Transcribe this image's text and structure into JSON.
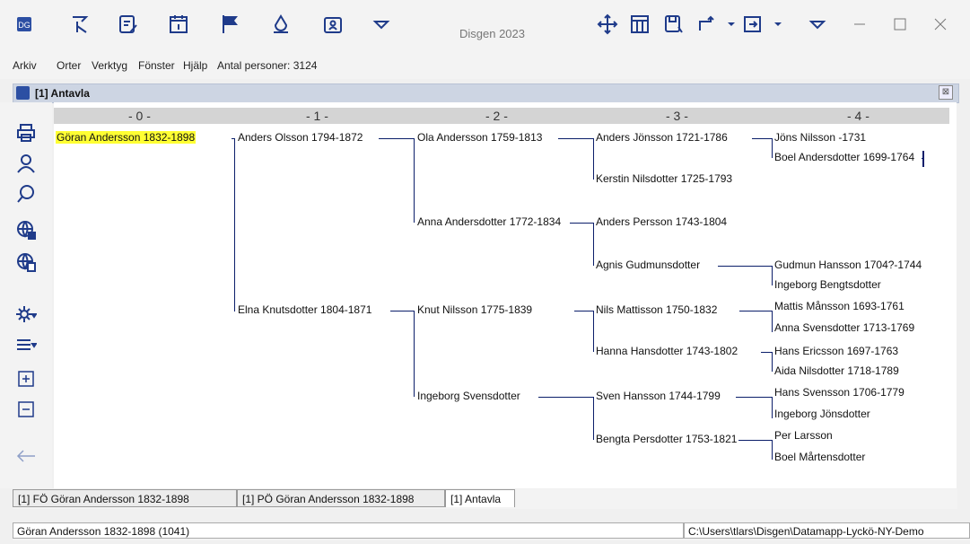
{
  "app_title": "Disgen 2023",
  "menu": {
    "arkiv": "Arkiv",
    "orter": "Orter",
    "verktyg": "Verktyg",
    "fonster": "Fönster",
    "hjalp": "Hjälp",
    "count": "Antal personer: 3124"
  },
  "doc": {
    "title": "[1] Antavla",
    "close": "⊠"
  },
  "generations": [
    "- 0 -",
    "- 1 -",
    "- 2 -",
    "- 3 -",
    "- 4 -"
  ],
  "people": [
    "Göran Andersson 1832-1898",
    "Anders Olsson 1794-1872",
    "Elna Knutsdotter 1804-1871",
    "Ola Andersson 1759-1813",
    "Anna Andersdotter 1772-1834",
    "Knut Nilsson 1775-1839",
    "Ingeborg Svensdotter",
    "Anders Jönsson 1721-1786",
    "Kerstin Nilsdotter 1725-1793",
    "Anders Persson 1743-1804",
    "Agnis Gudmunsdotter",
    "Nils Mattisson 1750-1832",
    "Hanna Hansdotter 1743-1802",
    "Sven Hansson 1744-1799",
    "Bengta Persdotter 1753-1821",
    "Jöns Nilsson -1731",
    "Boel Andersdotter 1699-1764",
    "Gudmun Hansson 1704?-1744",
    "Ingeborg Bengtsdotter",
    "Mattis Månsson 1693-1761",
    "Anna Svensdotter 1713-1769",
    "Hans Ericsson 1697-1763",
    "Aida Nilsdotter 1718-1789",
    "Hans Svensson 1706-1779",
    "Ingeborg Jönsdotter",
    "Per Larsson",
    "Boel Mårtensdotter"
  ],
  "tabs": [
    "[1]  FÖ Göran Andersson 1832-1898",
    "[1]  PÖ Göran Andersson 1832-1898",
    "[1] Antavla"
  ],
  "status": {
    "left": "Göran Andersson 1832-1898 (1041)",
    "right": "C:\\Users\\tlars\\Disgen\\Datamapp-Lyckö-NY-Demo"
  },
  "colors": {
    "accent": "#1f3b8a",
    "highlight": "#ffff33",
    "line": "#0b1e6a"
  },
  "icons": [
    "directions-icon",
    "edit-note-icon",
    "calendar-icon",
    "flag-icon",
    "drop-icon",
    "folder-person-icon",
    "dropdown-icon",
    "move-icon",
    "layout-icon",
    "save-icon",
    "branch-icon",
    "swap-icon",
    "print-icon",
    "person-icon",
    "search-icon",
    "globe-add-icon",
    "globe-window-icon",
    "settings-icon",
    "list-icon",
    "expand-icon",
    "collapse-icon",
    "back-arrow-icon"
  ]
}
